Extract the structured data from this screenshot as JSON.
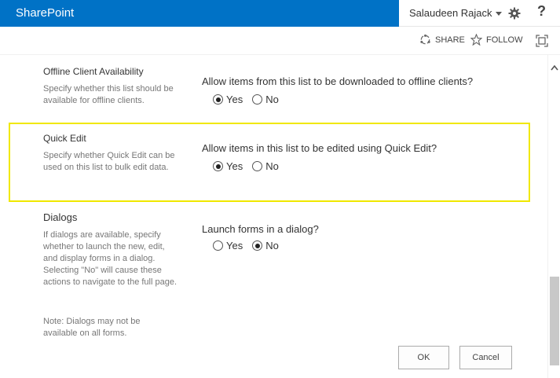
{
  "suite": {
    "brand": "SharePoint",
    "user": "Salaudeen Rajack",
    "help": "?"
  },
  "actions": {
    "share": "SHARE",
    "follow": "FOLLOW"
  },
  "sections": [
    {
      "title": "Offline Client Availability",
      "description": "Specify whether this list should be available for offline clients.",
      "question": "Allow items from this list to be downloaded to offline clients?",
      "options": [
        "Yes",
        "No"
      ],
      "selected": "Yes"
    },
    {
      "title": "Quick Edit",
      "description": "Specify whether Quick Edit can be used on this list to bulk edit data.",
      "question": "Allow items in this list to be edited using Quick Edit?",
      "options": [
        "Yes",
        "No"
      ],
      "selected": "Yes"
    },
    {
      "title": "Dialogs",
      "description": "If dialogs are available, specify whether to launch the new, edit, and display forms in a dialog. Selecting \"No\" will cause these actions to navigate to the full page.",
      "note": "Note: Dialogs may not be available on all forms.",
      "question": "Launch forms in a dialog?",
      "options": [
        "Yes",
        "No"
      ],
      "selected": "No"
    }
  ],
  "buttons": {
    "ok": "OK",
    "cancel": "Cancel"
  },
  "colors": {
    "suite_blue": "#0072c6",
    "highlight": "#f0e800"
  }
}
